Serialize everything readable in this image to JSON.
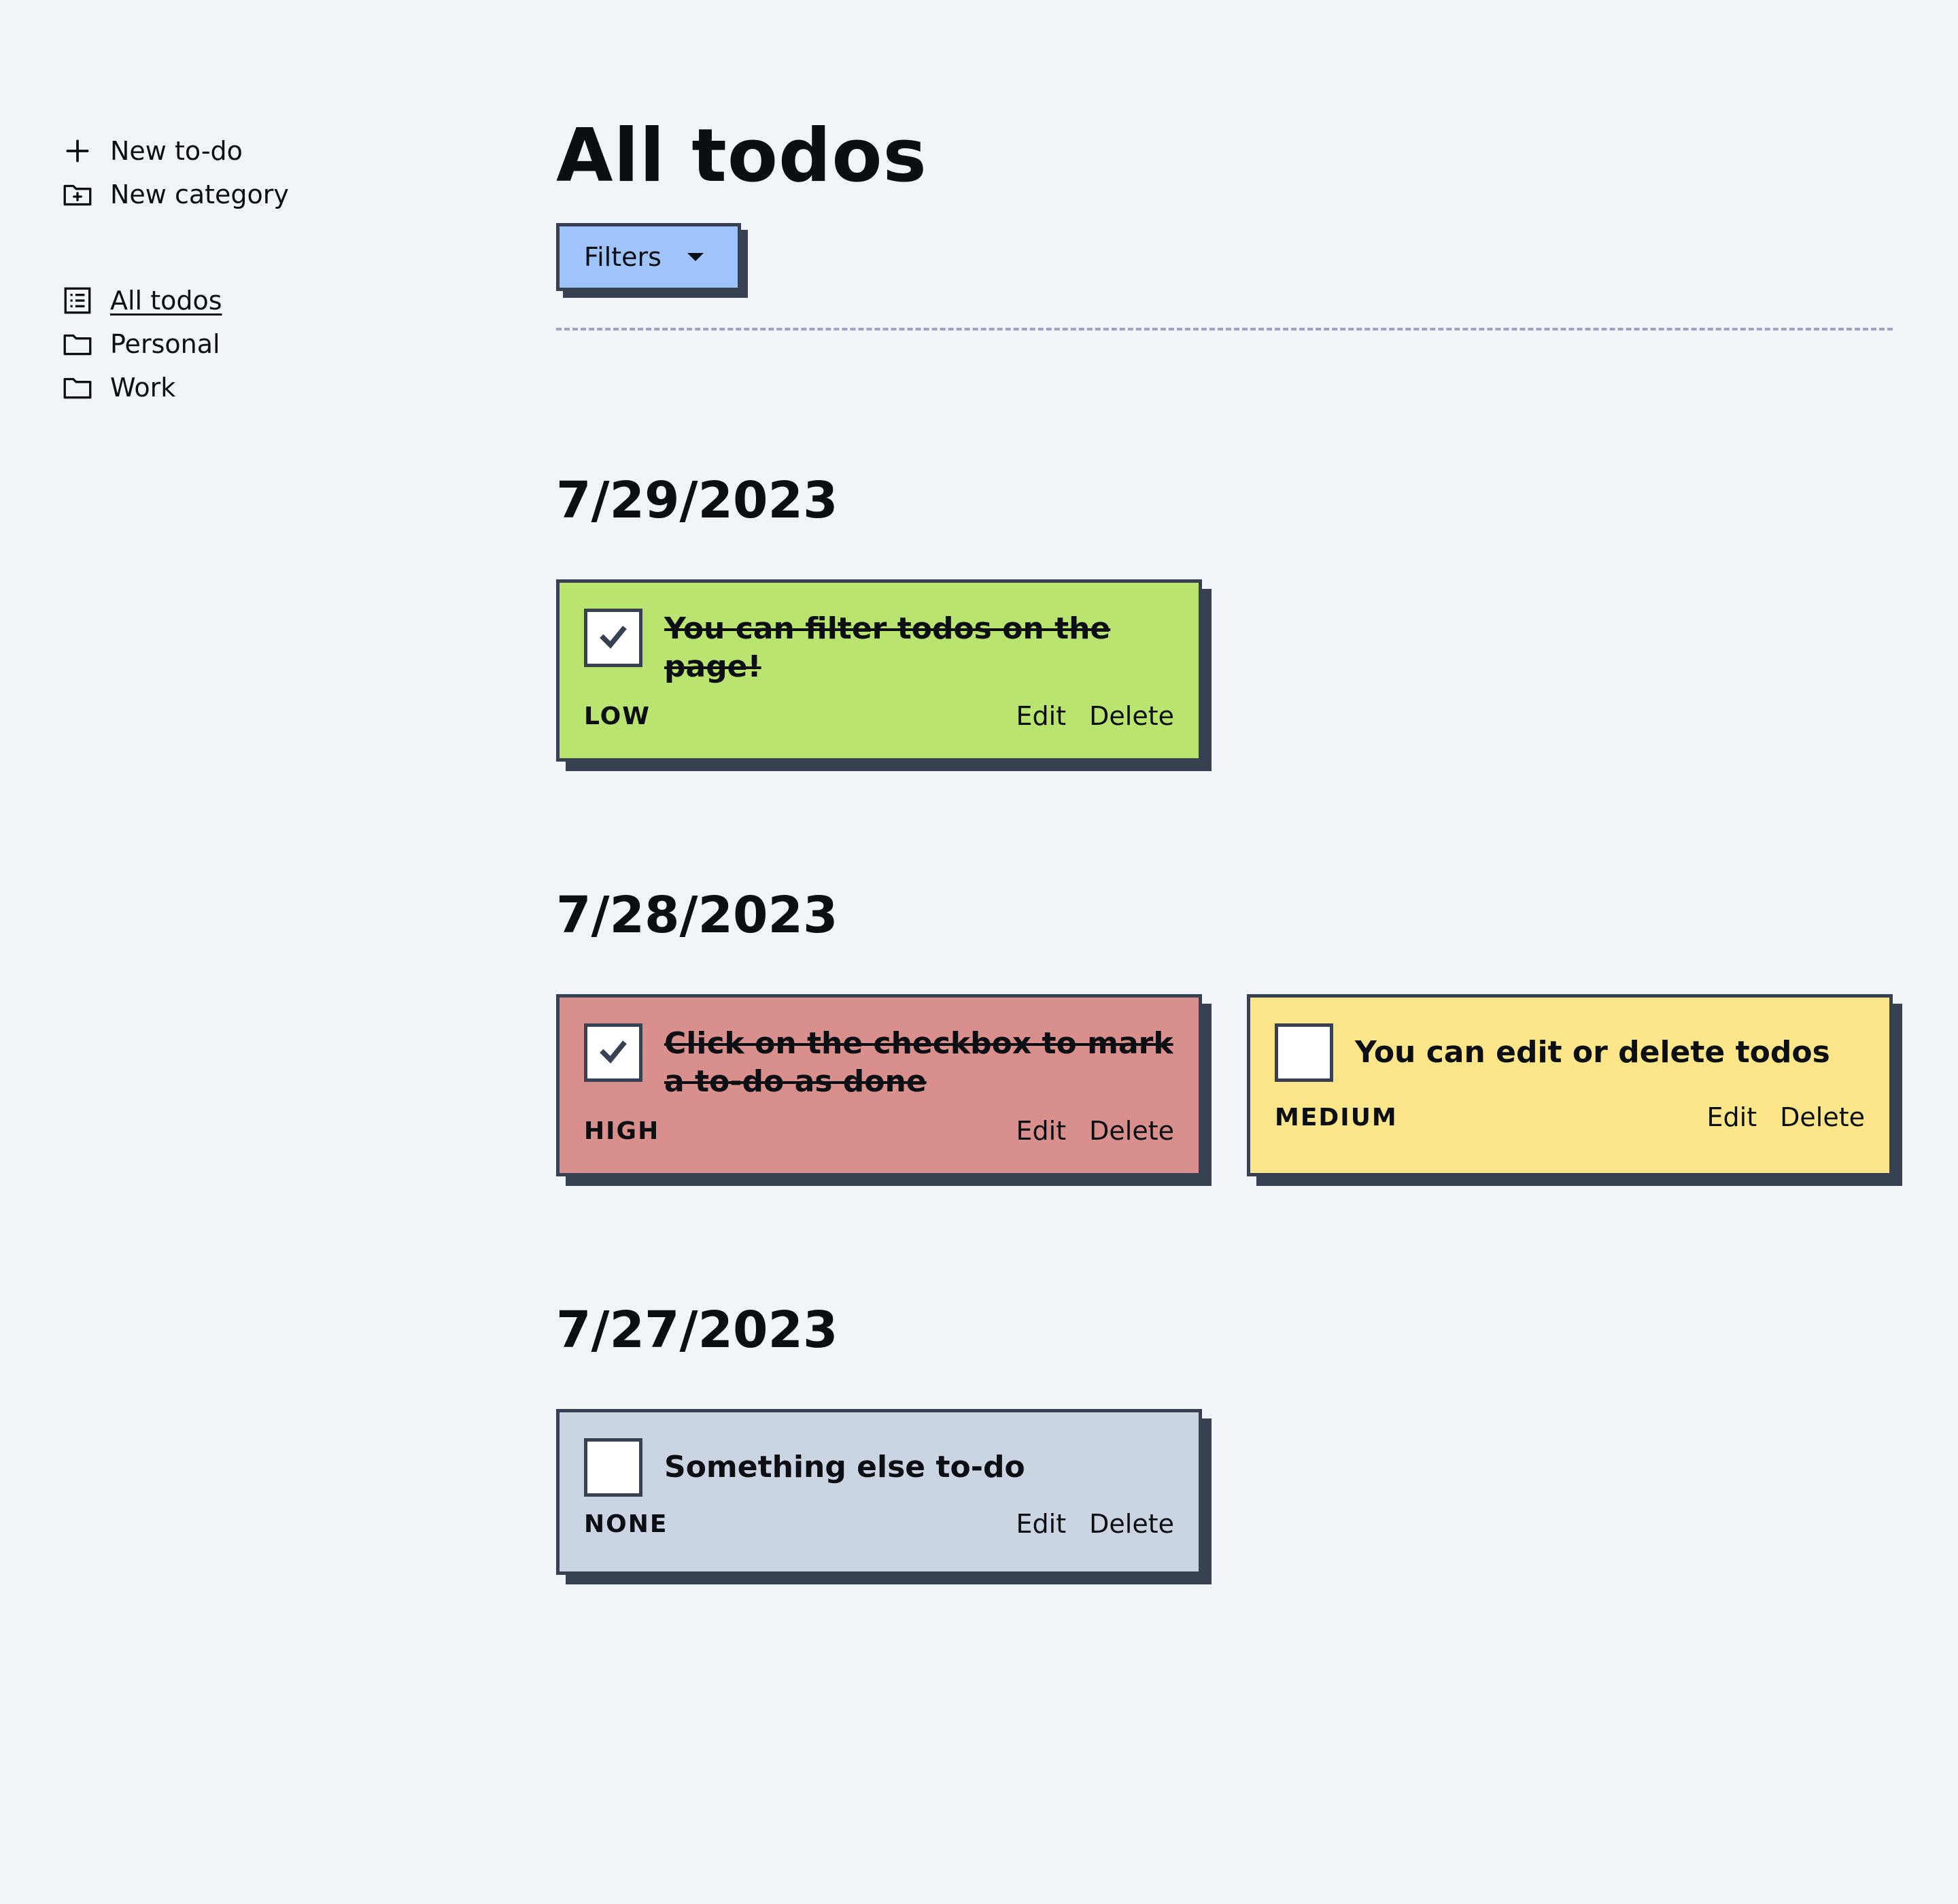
{
  "sidebar": {
    "actions": [
      {
        "label": "New to-do",
        "icon": "plus-icon"
      },
      {
        "label": "New category",
        "icon": "folder-plus-icon"
      }
    ],
    "categories": [
      {
        "label": "All todos",
        "icon": "list-icon",
        "active": true
      },
      {
        "label": "Personal",
        "icon": "folder-icon",
        "active": false
      },
      {
        "label": "Work",
        "icon": "folder-icon",
        "active": false
      }
    ]
  },
  "main": {
    "title": "All todos",
    "filters_label": "Filters"
  },
  "colors": {
    "background": "#f1f5f9",
    "filters": "#9fc3fb",
    "low": "#b9e46f",
    "high": "#d9908d",
    "medium": "#fde589",
    "none": "#cbd5e1",
    "border": "#374151"
  },
  "groups": [
    {
      "date": "7/29/2023",
      "todos": [
        {
          "title": "You can filter todos on the page!",
          "priority": "LOW",
          "done": true,
          "edit": "Edit",
          "delete": "Delete"
        }
      ]
    },
    {
      "date": "7/28/2023",
      "todos": [
        {
          "title": "Click on the checkbox to mark a to-do as done",
          "priority": "HIGH",
          "done": true,
          "edit": "Edit",
          "delete": "Delete"
        },
        {
          "title": "You can edit or delete todos",
          "priority": "MEDIUM",
          "done": false,
          "edit": "Edit",
          "delete": "Delete"
        }
      ]
    },
    {
      "date": "7/27/2023",
      "todos": [
        {
          "title": "Something else to-do",
          "priority": "NONE",
          "done": false,
          "edit": "Edit",
          "delete": "Delete"
        }
      ]
    }
  ]
}
